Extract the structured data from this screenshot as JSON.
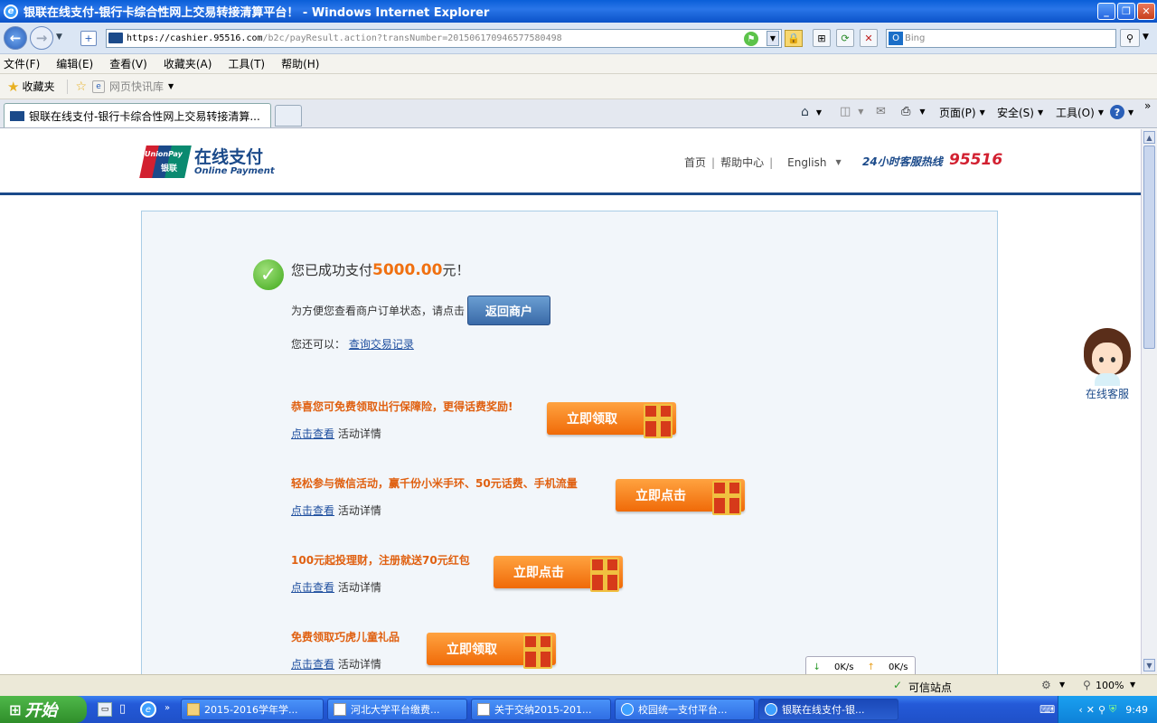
{
  "window": {
    "title": "银联在线支付-银行卡综合性网上交易转接清算平台！ - Windows Internet Explorer"
  },
  "address": {
    "url_prefix": "https://cashier.",
    "url_domain": "95516.com",
    "url_path": "/b2c/payResult.action?transNumber=201506170946577580498",
    "search_placeholder": "Bing"
  },
  "menu": {
    "items": [
      "文件(F)",
      "编辑(E)",
      "查看(V)",
      "收藏夹(A)",
      "工具(T)",
      "帮助(H)"
    ]
  },
  "favorites": {
    "label": "收藏夹",
    "quicklib": "网页快讯库"
  },
  "tabs": [
    {
      "label": "银联在线支付-银行卡综合性网上交易转接清算..."
    }
  ],
  "toolbar": {
    "page": "页面(P)",
    "safety": "安全(S)",
    "tools": "工具(O)"
  },
  "header": {
    "logo_main": "在线支付",
    "logo_sub": "Online Payment",
    "logo_mark": "UnionPay",
    "logo_mark_cn": "银联",
    "nav_home": "首页",
    "nav_help": "帮助中心",
    "nav_lang": "English",
    "hotline_label": "24小时客服热线",
    "hotline_number": "95516"
  },
  "result": {
    "prefix": "您已成功支付",
    "amount": "5000.00",
    "suffix": "元！",
    "hint": "为方便您查看商户订单状态，请点击",
    "return_label": "返回商户",
    "also_label": "您还可以：",
    "query_link": "查询交易记录"
  },
  "promos": [
    {
      "title": "恭喜您可免费领取出行保障险，更得话费奖励!",
      "button": "立即领取",
      "link": "点击查看",
      "detail": "活动详情"
    },
    {
      "title": "轻松参与微信活动，赢千份小米手环、50元话费、手机流量",
      "button": "立即点击",
      "link": "点击查看",
      "detail": "活动详情"
    },
    {
      "title": "100元起投理财，注册就送70元红包",
      "button": "立即点击",
      "link": "点击查看",
      "detail": "活动详情"
    },
    {
      "title": "免费领取巧虎儿童礼品",
      "button": "立即领取",
      "link": "点击查看",
      "detail": "活动详情"
    }
  ],
  "speed": {
    "down": "0K/s",
    "up": "0K/s"
  },
  "service": {
    "label": "在线客服"
  },
  "status": {
    "zone": "可信站点",
    "zoom": "100%"
  },
  "taskbar": {
    "start": "开始",
    "tasks": [
      "2015-2016学年学...",
      "河北大学平台缴费...",
      "关于交纳2015-201...",
      "校园统一支付平台...",
      "银联在线支付-银..."
    ],
    "clock": "9:49"
  },
  "colors": {
    "brand_blue": "#1b4a8a",
    "accent_orange": "#f07010",
    "unionpay_red": "#d22030"
  }
}
